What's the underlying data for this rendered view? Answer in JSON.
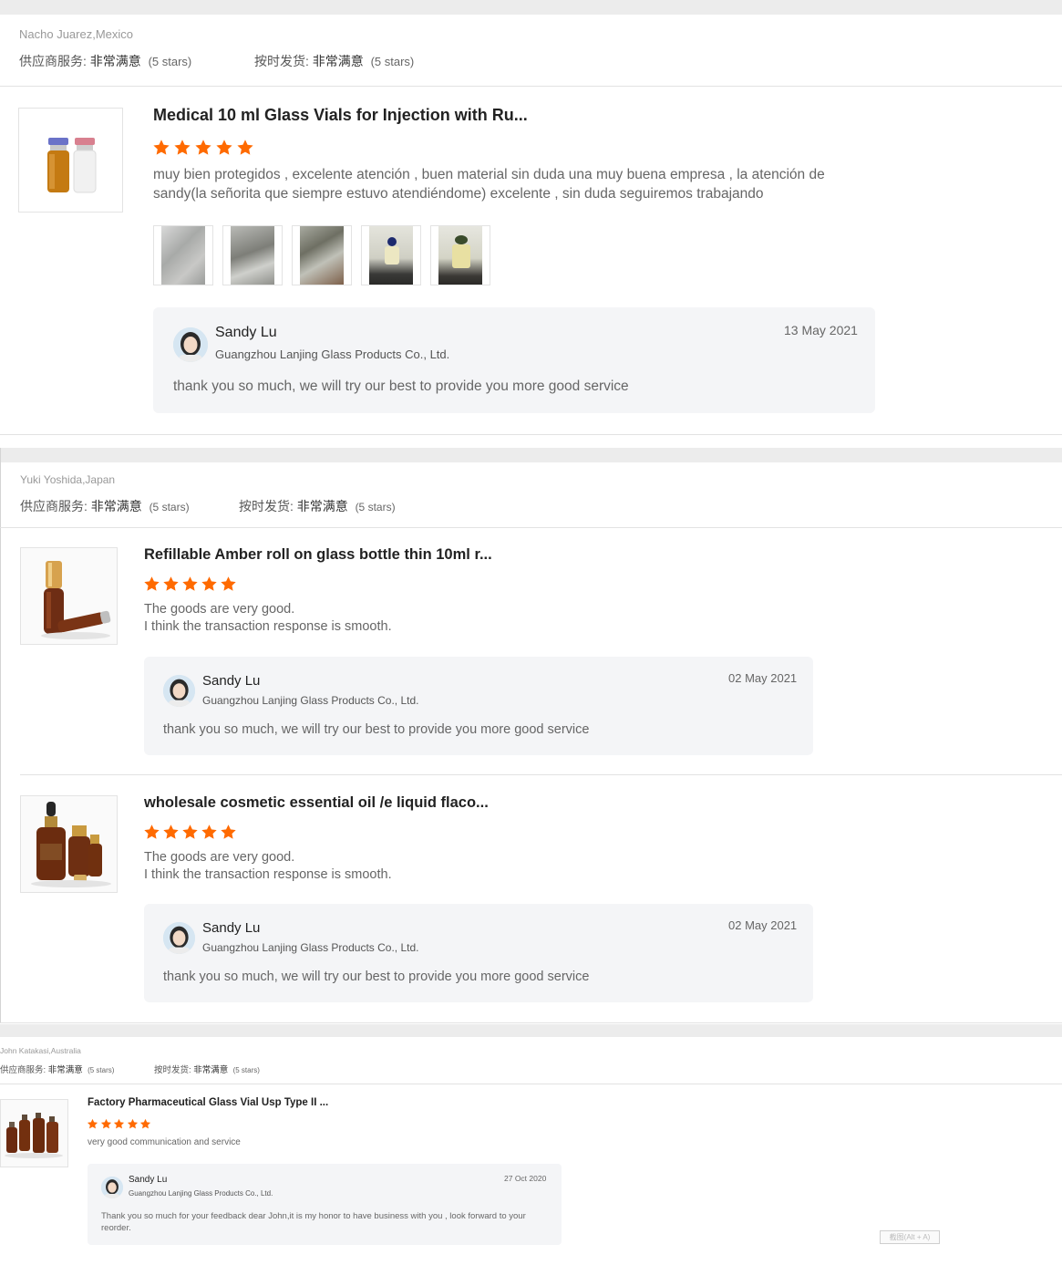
{
  "labels": {
    "supplier_service": "供应商服务:",
    "on_time_delivery": "按时发货:",
    "very_satisfied": "非常满意",
    "five_stars": "(5 stars)"
  },
  "colors": {
    "star": "#ff6a00",
    "reply_bg": "#f4f5f7",
    "band": "#ececec"
  },
  "rating": 5,
  "shortcut_hint": "截图(Alt + A)",
  "reviews": [
    {
      "buyer": "Nacho Juarez,Mexico",
      "items": [
        {
          "thumb_icon": "vials-icon",
          "title": "Medical 10 ml Glass Vials for Injection with Ru...",
          "text": "muy bien protegidos , excelente atención , buen material sin duda una muy buena empresa , la atención de sandy(la señorita que siempre estuvo atendiéndome) excelente , sin duda seguiremos trabajando",
          "photos": [
            "photo-1",
            "photo-2",
            "photo-3",
            "photo-4",
            "photo-5"
          ],
          "reply": {
            "name": "Sandy Lu",
            "company": "Guangzhou Lanjing Glass Products Co., Ltd.",
            "date": "13 May 2021",
            "text": "thank you so much, we will try our best to provide you more good service"
          }
        }
      ]
    },
    {
      "buyer": "Yuki Yoshida,Japan",
      "items": [
        {
          "thumb_icon": "roll-on-bottle-icon",
          "title": "Refillable Amber roll on glass bottle thin 10ml r...",
          "text": "The goods are very good.\nI think the transaction response is smooth.",
          "reply": {
            "name": "Sandy Lu",
            "company": "Guangzhou Lanjing Glass Products Co., Ltd.",
            "date": "02 May 2021",
            "text": "thank you so much, we will try our best to provide you more good service"
          }
        },
        {
          "thumb_icon": "dropper-bottles-icon",
          "title": "wholesale cosmetic essential oil /e liquid flaco...",
          "text": "The goods are very good.\nI think the transaction response is smooth.",
          "reply": {
            "name": "Sandy Lu",
            "company": "Guangzhou Lanjing Glass Products Co., Ltd.",
            "date": "02 May 2021",
            "text": "thank you so much, we will try our best to provide you more good service"
          }
        }
      ]
    },
    {
      "buyer": "John Katakasi,Australia",
      "items": [
        {
          "thumb_icon": "amber-vials-icon",
          "title": "Factory Pharmaceutical Glass Vial Usp Type II ...",
          "text": "very good communication and service",
          "reply": {
            "name": "Sandy Lu",
            "company": "Guangzhou Lanjing Glass Products Co., Ltd.",
            "date": "27 Oct 2020",
            "text": "Thank you so much for your feedback dear John,it is my honor to have business with you , look forward to your reorder."
          }
        }
      ]
    }
  ]
}
